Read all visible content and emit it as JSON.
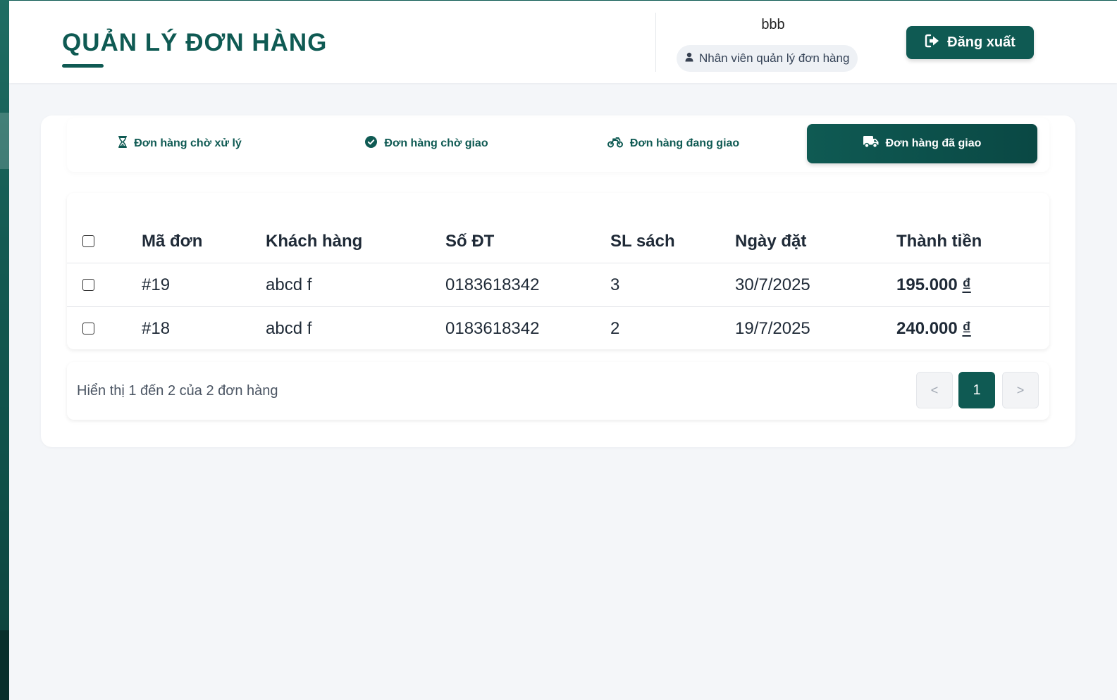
{
  "header": {
    "title": "QUẢN LÝ ĐƠN HÀNG",
    "user": {
      "name": "bbb",
      "role": "Nhân viên quản lý đơn hàng"
    },
    "logout_label": "Đăng xuất"
  },
  "tabs": [
    {
      "label": "Đơn hàng chờ xử lý",
      "icon": "hourglass-icon",
      "active": false
    },
    {
      "label": "Đơn hàng chờ giao",
      "icon": "check-circle-icon",
      "active": false
    },
    {
      "label": "Đơn hàng đang giao",
      "icon": "motorcycle-icon",
      "active": false
    },
    {
      "label": "Đơn hàng đã giao",
      "icon": "truck-icon",
      "active": true
    }
  ],
  "table": {
    "headers": [
      "Mã đơn",
      "Khách hàng",
      "Số ĐT",
      "SL sách",
      "Ngày đặt",
      "Thành tiền"
    ],
    "rows": [
      {
        "id": "#19",
        "customer": "abcd f",
        "phone": "0183618342",
        "qty": "3",
        "date": "30/7/2025",
        "total": "195.000",
        "currency": "₫"
      },
      {
        "id": "#18",
        "customer": "abcd f",
        "phone": "0183618342",
        "qty": "2",
        "date": "19/7/2025",
        "total": "240.000",
        "currency": "₫"
      }
    ]
  },
  "pagination": {
    "summary": "Hiển thị 1 đến 2 của 2 đơn hàng",
    "prev": "<",
    "current": "1",
    "next": ">"
  },
  "colors": {
    "primary": "#0f5a53",
    "background": "#f4f6f9"
  }
}
